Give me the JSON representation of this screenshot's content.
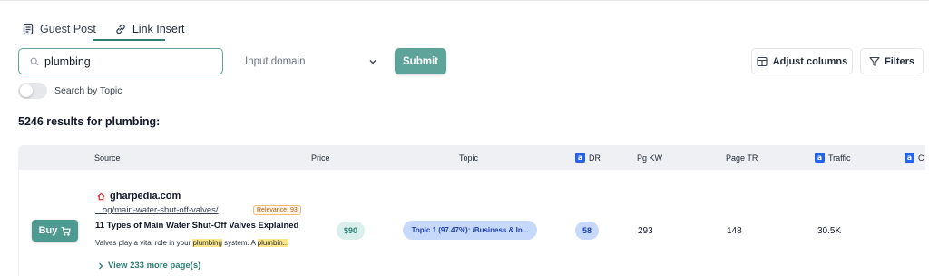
{
  "tabs": [
    {
      "label": "Guest Post",
      "icon": "document-icon",
      "active": false
    },
    {
      "label": "Link Insert",
      "icon": "link-icon",
      "active": true
    }
  ],
  "search": {
    "value": "plumbing",
    "placeholder": "Search"
  },
  "domain_select": {
    "placeholder": "Input domain"
  },
  "submit_label": "Submit",
  "adjust_columns_label": "Adjust columns",
  "filters_label": "Filters",
  "toggle": {
    "label": "Search by Topic",
    "on": false
  },
  "results_text": "5246 results for plumbing:",
  "columns": {
    "source": "Source",
    "price": "Price",
    "topic": "Topic",
    "dr": "DR",
    "pg_kw": "Pg KW",
    "page_tr": "Page TR",
    "traffic": "Traffic",
    "next": "C"
  },
  "row": {
    "buy_label": "Buy",
    "site": "gharpedia.com",
    "url": "...og/main-water-shut-off-valves/",
    "relevance": "Relevance: 93",
    "title": "11 Types of Main Water Shut-Off Valves Explained",
    "snippet_pre": "Valves play a vital role in your ",
    "snippet_hl1": "plumbing",
    "snippet_mid": " system. A ",
    "snippet_hl2": "plumbin...",
    "more": "View 233 more page(s)",
    "price": "$90",
    "topic": "Topic 1 (97.47%): /Business & In...",
    "dr": "58",
    "pg_kw": "293",
    "page_tr": "148",
    "traffic": "30.5K"
  },
  "colors": {
    "accent": "#5fa49b",
    "pill_blue": "#c7d9fb",
    "highlight": "#fde68a"
  }
}
